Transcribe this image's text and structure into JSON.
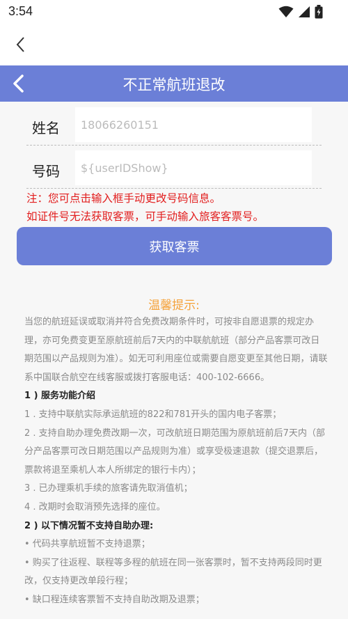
{
  "status_bar": {
    "time": "3:54",
    "icons": [
      "wifi-icon",
      "cellular-signal-icon",
      "battery-charging-icon"
    ]
  },
  "header": {
    "title": "不正常航班退改"
  },
  "form": {
    "name_label": "姓名",
    "name_value": "18066260151",
    "number_label": "号码",
    "number_value": "${userIDShow}"
  },
  "notes": {
    "line1": "注：您可点击输入框手动更改号码信息。",
    "line2": "如证件号无法获取客票，可手动输入旅客客票号。"
  },
  "action": {
    "get_ticket_label": "获取客票"
  },
  "tips": {
    "title": "温馨提示:",
    "intro": "当您的航班延误或取消并符合免费改期条件时，可按非自愿退票的规定办理，亦可免费变更至原航班前后7天内的中联航航班（部分产品客票可改日期范围以产品规则为准）。如无可利用座位或需要自愿变更至其他日期，请联系中国联合航空在线客服或拨打客服电话：400-102-6666。",
    "section1_title": "1 ) 服务功能介绍",
    "section1_items": [
      "1 . 支持中联航实际承运航班的822和781开头的国内电子客票；",
      "2 . 支持自助办理免费改期一次，可改航班日期范围为原航班前后7天内（部分产品客票可改日期范围以产品规则为准）或享受极速退款（提交退票后，票款将退至乘机人本人所绑定的银行卡内）；",
      "3 . 已办理乘机手续的旅客请先取消值机；",
      "4 . 改期时会取消预先选择的座位。"
    ],
    "section2_title": "2 ) 以下情况暂不支持自助办理:",
    "section2_items": [
      "• 代码共享航班暂不支持退票；",
      "• 购买了往返程、联程等多程的航班在同一张客票时，暂不支持两段同时更改，仅支持更改单段行程；",
      "• 缺口程连续客票暂不支持自助改期及退票；"
    ]
  },
  "colors": {
    "accent": "#6b7fd7",
    "note_red": "#e21d1d",
    "tips_orange": "#f5a23a"
  }
}
